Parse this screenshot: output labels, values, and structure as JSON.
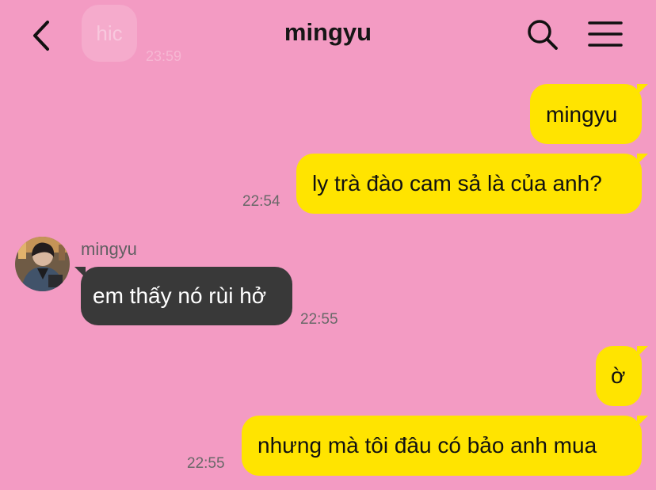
{
  "header": {
    "title": "mingyu"
  },
  "faded_message": {
    "text": "hic",
    "time": "23:59"
  },
  "messages": [
    {
      "side": "right",
      "text": "mingyu"
    },
    {
      "side": "right",
      "text": "ly trà đào cam sả là của anh?",
      "time": "22:54"
    },
    {
      "side": "left",
      "sender": "mingyu",
      "text": "em thấy nó rùi hở",
      "time": "22:55"
    },
    {
      "side": "right",
      "text": "ờ"
    },
    {
      "side": "right",
      "text": "nhưng mà tôi đâu có bảo anh mua",
      "time": "22:55"
    }
  ],
  "colors": {
    "background": "#f39bc3",
    "outgoing_bubble": "#ffe400",
    "incoming_bubble": "#393939"
  },
  "icons": [
    "back-icon",
    "search-icon",
    "menu-icon"
  ]
}
